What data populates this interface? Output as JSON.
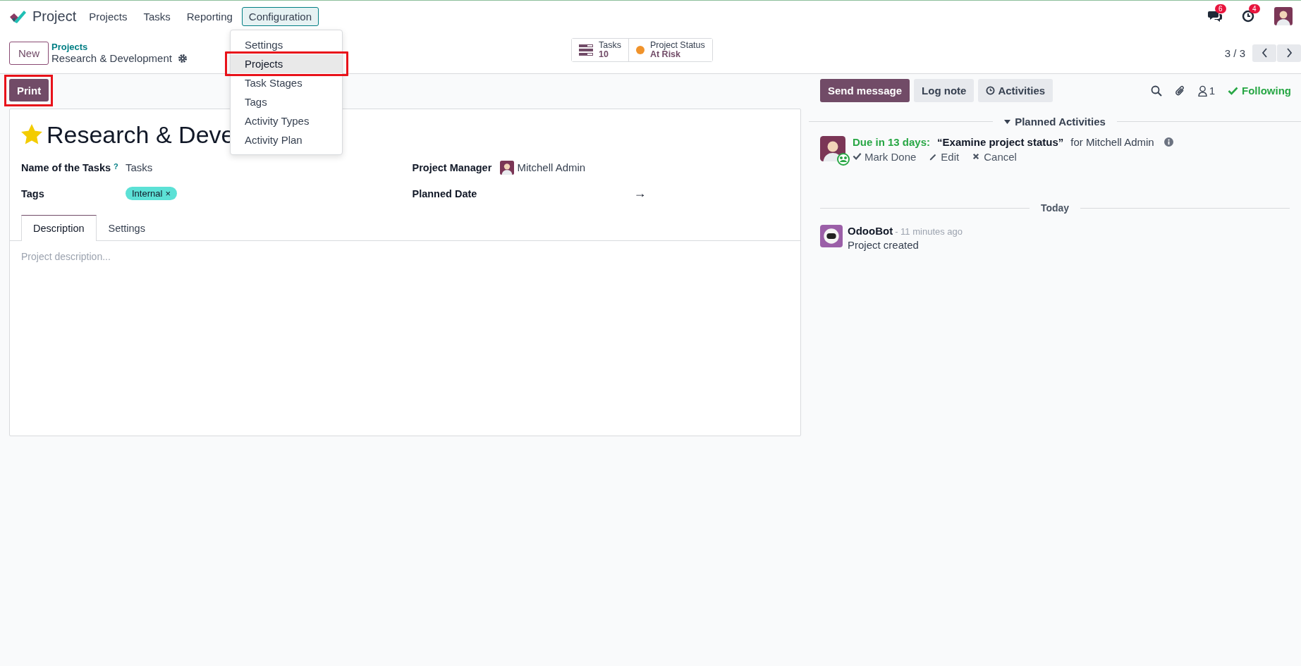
{
  "navbar": {
    "app_name": "Project",
    "menu": [
      {
        "label": "Projects",
        "selected": false
      },
      {
        "label": "Tasks",
        "selected": false
      },
      {
        "label": "Reporting",
        "selected": false
      },
      {
        "label": "Configuration",
        "selected": true
      }
    ],
    "messages_badge": "6",
    "activities_badge": "4"
  },
  "dropdown": {
    "items": [
      {
        "label": "Settings",
        "selected": false,
        "highlighted": false
      },
      {
        "label": "Projects",
        "selected": true,
        "highlighted": true
      },
      {
        "label": "Task Stages",
        "selected": false,
        "highlighted": false
      },
      {
        "label": "Tags",
        "selected": false,
        "highlighted": false
      },
      {
        "label": "Activity Types",
        "selected": false,
        "highlighted": false
      },
      {
        "label": "Activity Plan",
        "selected": false,
        "highlighted": false
      }
    ]
  },
  "control_panel": {
    "new_button": "New",
    "breadcrumb_parent": "Projects",
    "record_name": "Research & Development",
    "stat_buttons": [
      {
        "kind": "tasks",
        "label": "Tasks",
        "value": "10"
      },
      {
        "kind": "status",
        "label": "Project Status",
        "value": "At Risk",
        "color": "#f0932b"
      }
    ],
    "pager": "3 / 3"
  },
  "toolbar": {
    "print_button": "Print",
    "print_highlighted": true
  },
  "form": {
    "favorite": true,
    "title": "Research & Deve",
    "left_fields": [
      {
        "kind": "text",
        "label": "Name of the Tasks",
        "help": "?",
        "value": "Tasks"
      },
      {
        "kind": "tags",
        "label": "Tags",
        "tags": [
          {
            "label": "Internal",
            "remove": "×",
            "color": "#5ce1d6"
          }
        ]
      }
    ],
    "right_fields": [
      {
        "kind": "user",
        "label": "Project Manager",
        "value": "Mitchell Admin"
      },
      {
        "kind": "daterange",
        "label": "Planned Date",
        "separator": "→"
      }
    ],
    "tabs": [
      {
        "label": "Description",
        "selected": true
      },
      {
        "label": "Settings",
        "selected": false
      }
    ],
    "description_placeholder": "Project description..."
  },
  "chatter": {
    "buttons": [
      {
        "kind": "primary",
        "label": "Send message"
      },
      {
        "kind": "secondary",
        "label": "Log note"
      },
      {
        "kind": "activities",
        "label": "Activities"
      }
    ],
    "followers_count": "1",
    "following": true,
    "following_label": "Following",
    "planned_header": "Planned Activities",
    "activities": [
      {
        "due": "Due in 13 days:",
        "summary": "“Examine project status”",
        "assignee": "for Mitchell Admin",
        "actions": [
          "Mark Done",
          "Edit",
          "Cancel"
        ]
      }
    ],
    "date_separator": "Today",
    "messages": [
      {
        "author": "OdooBot",
        "time": "- 11 minutes ago",
        "body": "Project created"
      }
    ]
  }
}
